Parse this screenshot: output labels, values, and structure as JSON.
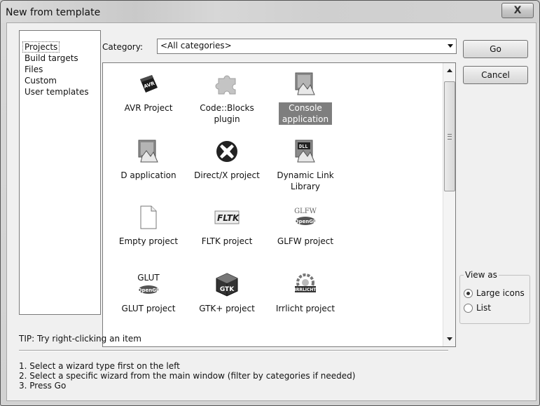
{
  "window": {
    "title": "New from template",
    "close_glyph": "X"
  },
  "left_list": {
    "items": [
      "Projects",
      "Build targets",
      "Files",
      "Custom",
      "User templates"
    ]
  },
  "category": {
    "label": "Category:",
    "value": "<All categories>"
  },
  "templates": [
    {
      "label": "AVR Project",
      "icon": "avr-chip-icon"
    },
    {
      "label": "Code::Blocks plugin",
      "icon": "puzzle-plugin-icon"
    },
    {
      "label": "Console application",
      "icon": "console-app-icon",
      "selected": true
    },
    {
      "label": "D application",
      "icon": "app-window-icon"
    },
    {
      "label": "Direct/X project",
      "icon": "directx-icon"
    },
    {
      "label": "Dynamic Link Library",
      "icon": "dll-icon"
    },
    {
      "label": "Empty project",
      "icon": "blank-page-icon"
    },
    {
      "label": "FLTK project",
      "icon": "fltk-icon"
    },
    {
      "label": "GLFW project",
      "icon": "glfw-opengl-icon"
    },
    {
      "label": "GLUT project",
      "icon": "glut-opengl-icon"
    },
    {
      "label": "GTK+ project",
      "icon": "gtk-cube-icon"
    },
    {
      "label": "Irrlicht project",
      "icon": "irrlicht-gear-icon"
    }
  ],
  "icon_text": {
    "avr": "AVR",
    "dll": "DLL",
    "fltk": "FLTK",
    "glfw": "GLFW",
    "glut": "GLUT",
    "opengl": "OpenGL",
    "irrlicht": "IRRLICHT",
    "gtk": "GTK"
  },
  "buttons": {
    "go": "Go",
    "cancel": "Cancel"
  },
  "view_as": {
    "legend": "View as",
    "large_icons": "Large icons",
    "list": "List",
    "selected": "large_icons"
  },
  "tip": "TIP: Try right-clicking an item",
  "instructions": [
    "1. Select a wizard type first on the left",
    "2. Select a specific wizard from the main window (filter by categories if needed)",
    "3. Press Go"
  ]
}
